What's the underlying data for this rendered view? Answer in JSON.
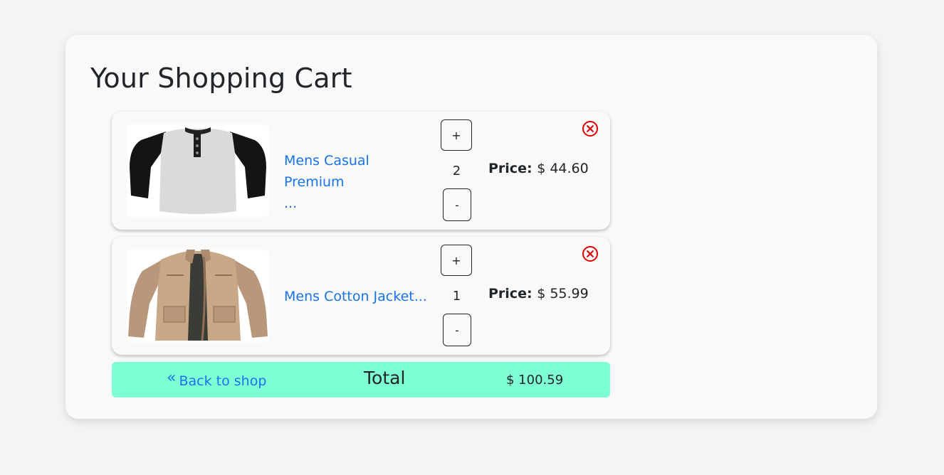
{
  "cart": {
    "title": "Your Shopping Cart",
    "items": [
      {
        "name_line1": "Mens Casual Premium",
        "name_line2": "...",
        "quantity": "2",
        "increment_label": "+",
        "decrement_label": "-",
        "price_label": "Price:",
        "price_value": "$ 44.60",
        "image": "shirt-image"
      },
      {
        "name_line1": "Mens Cotton Jacket...",
        "quantity": "1",
        "increment_label": "+",
        "decrement_label": "-",
        "price_label": "Price:",
        "price_value": "$ 55.99",
        "image": "jacket-image"
      }
    ],
    "footer": {
      "back_icon": "double-chevron-left-icon",
      "back_label": "Back to shop",
      "total_label": "Total",
      "total_value": "$ 100.59"
    },
    "remove_icon": "close-circle-icon"
  },
  "colors": {
    "link": "#1a73e8",
    "remove": "#e00000",
    "footer_bg": "#7fffd4",
    "page_bg": "#f4f4f4",
    "card_bg": "#f9f9f9"
  }
}
